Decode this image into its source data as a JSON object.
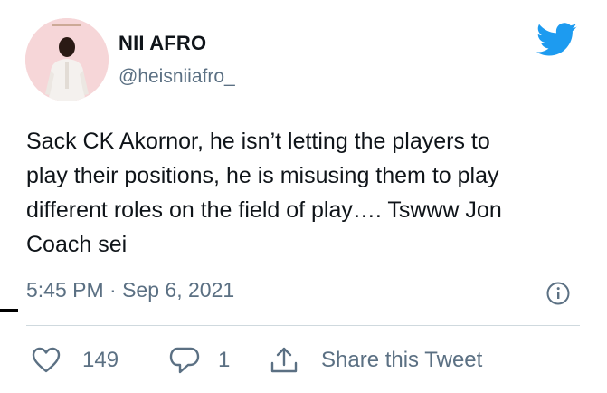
{
  "user": {
    "display_name": "NII AFRO",
    "handle": "@heisniiafro_",
    "avatar_icon": "profile-photo"
  },
  "tweet": {
    "text": "Sack CK Akornor, he isn’t letting the players to\nplay their positions, he is misusing them to play\ndifferent roles on the field of play…. Tswww Jon\nCoach sei",
    "timestamp": "5:45 PM · Sep 6, 2021"
  },
  "actions": {
    "likes": "149",
    "replies": "1",
    "share_label": "Share this Tweet"
  },
  "icons": {
    "brand": "twitter-bird-icon",
    "info": "info-icon",
    "like": "heart-icon",
    "reply": "reply-bubble-icon",
    "share": "share-icon"
  },
  "colors": {
    "twitter_blue": "#1d9bf0",
    "secondary_text": "#5b7083",
    "divider": "#cfd9de",
    "avatar_bg": "#f6d6d8"
  }
}
